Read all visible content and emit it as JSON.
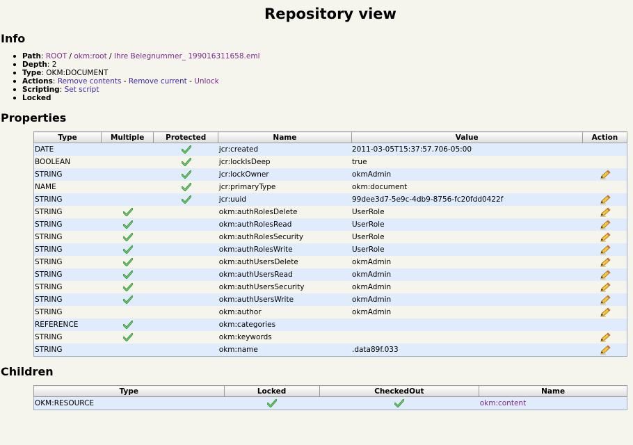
{
  "title": "Repository view",
  "info": {
    "heading": "Info",
    "path_label": "Path",
    "path": [
      "ROOT",
      "okm:root",
      "Ihre Belegnummer_ 199016311658.eml"
    ],
    "path_sep": " / ",
    "depth_label": "Depth",
    "depth": "2",
    "type_label": "Type",
    "type": "OKM:DOCUMENT",
    "actions_label": "Actions",
    "actions": [
      "Remove contents",
      "Remove current",
      "Unlock"
    ],
    "actions_sep": " - ",
    "scripting_label": "Scripting",
    "scripting_action": "Set script",
    "locked_label": "Locked"
  },
  "properties": {
    "heading": "Properties",
    "columns": [
      "Type",
      "Multiple",
      "Protected",
      "Name",
      "Value",
      "Action"
    ],
    "rows": [
      {
        "type": "DATE",
        "multiple": false,
        "protected": true,
        "name": "jcr:created",
        "value": "2011-03-05T15:37:57.706-05:00",
        "editable": false
      },
      {
        "type": "BOOLEAN",
        "multiple": false,
        "protected": true,
        "name": "jcr:lockIsDeep",
        "value": "true",
        "editable": false
      },
      {
        "type": "STRING",
        "multiple": false,
        "protected": true,
        "name": "jcr:lockOwner",
        "value": "okmAdmin",
        "editable": true
      },
      {
        "type": "NAME",
        "multiple": false,
        "protected": true,
        "name": "jcr:primaryType",
        "value": "okm:document",
        "editable": false
      },
      {
        "type": "STRING",
        "multiple": false,
        "protected": true,
        "name": "jcr:uuid",
        "value": "99dee3d7-5e9c-4db9-8756-fc20fdd0422f",
        "editable": true
      },
      {
        "type": "STRING",
        "multiple": true,
        "protected": false,
        "name": "okm:authRolesDelete",
        "value": "UserRole",
        "editable": true
      },
      {
        "type": "STRING",
        "multiple": true,
        "protected": false,
        "name": "okm:authRolesRead",
        "value": "UserRole",
        "editable": true
      },
      {
        "type": "STRING",
        "multiple": true,
        "protected": false,
        "name": "okm:authRolesSecurity",
        "value": "UserRole",
        "editable": true
      },
      {
        "type": "STRING",
        "multiple": true,
        "protected": false,
        "name": "okm:authRolesWrite",
        "value": "UserRole",
        "editable": true
      },
      {
        "type": "STRING",
        "multiple": true,
        "protected": false,
        "name": "okm:authUsersDelete",
        "value": "okmAdmin",
        "editable": true
      },
      {
        "type": "STRING",
        "multiple": true,
        "protected": false,
        "name": "okm:authUsersRead",
        "value": "okmAdmin",
        "editable": true
      },
      {
        "type": "STRING",
        "multiple": true,
        "protected": false,
        "name": "okm:authUsersSecurity",
        "value": "okmAdmin",
        "editable": true
      },
      {
        "type": "STRING",
        "multiple": true,
        "protected": false,
        "name": "okm:authUsersWrite",
        "value": "okmAdmin",
        "editable": true
      },
      {
        "type": "STRING",
        "multiple": false,
        "protected": false,
        "name": "okm:author",
        "value": "okmAdmin",
        "editable": true
      },
      {
        "type": "REFERENCE",
        "multiple": true,
        "protected": false,
        "name": "okm:categories",
        "value": "",
        "editable": false
      },
      {
        "type": "STRING",
        "multiple": true,
        "protected": false,
        "name": "okm:keywords",
        "value": "",
        "editable": true
      },
      {
        "type": "STRING",
        "multiple": false,
        "protected": false,
        "name": "okm:name",
        "value": ".data89f.033",
        "editable": true
      }
    ]
  },
  "children": {
    "heading": "Children",
    "columns": [
      "Type",
      "Locked",
      "CheckedOut",
      "Name"
    ],
    "rows": [
      {
        "type": "OKM:RESOURCE",
        "locked": true,
        "checkedout": true,
        "name": "okm:content"
      }
    ]
  },
  "colors": {
    "background": "#f5f5ee",
    "row_alt": "#e0ebfb",
    "link": "#3d2aa4",
    "visited_link": "#7a2a8a",
    "check": "#3aa43a",
    "pencil": "#e0a020"
  },
  "icons": {
    "check": "check-icon",
    "edit": "pencil-icon"
  }
}
